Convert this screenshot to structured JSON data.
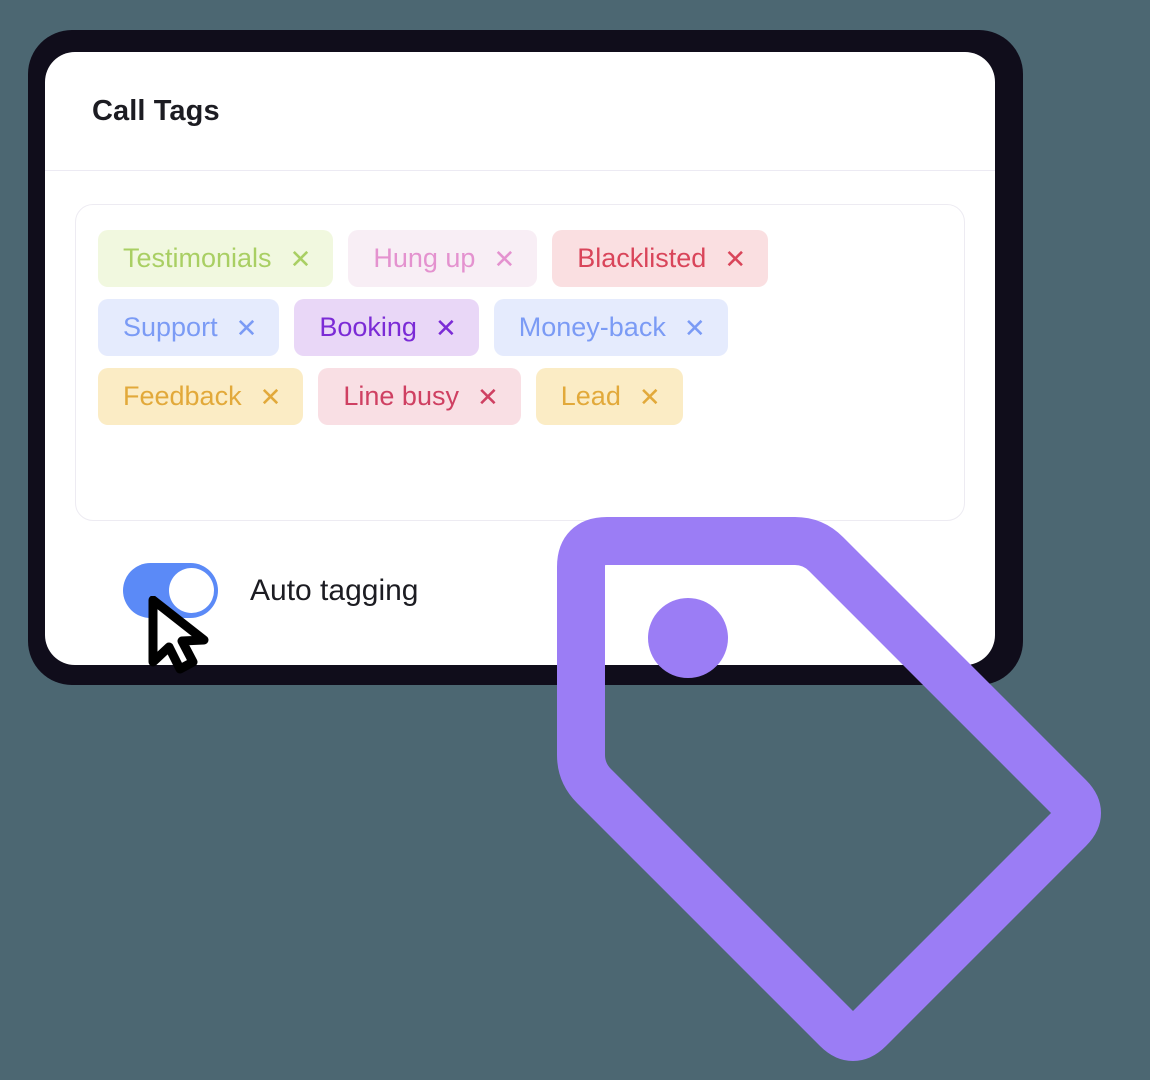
{
  "background": {
    "color": "#4c6772"
  },
  "card": {
    "title": "Call Tags",
    "background": "#ffffff",
    "shadow_color": "#100d1b"
  },
  "tags_panel": {
    "rows": [
      [
        {
          "label": "Testimonials",
          "remove_icon": "✕",
          "bg": "#f1f8df",
          "fg": "#a9cf63"
        },
        {
          "label": "Hung up",
          "remove_icon": "✕",
          "bg": "#f8eef5",
          "fg": "#e492cf"
        },
        {
          "label": "Blacklisted",
          "remove_icon": "✕",
          "bg": "#fadfe1",
          "fg": "#d9455a"
        }
      ],
      [
        {
          "label": "Support",
          "remove_icon": "✕",
          "bg": "#e5ebfd",
          "fg": "#7b9bf5"
        },
        {
          "label": "Booking",
          "remove_icon": "✕",
          "bg": "#e9d7f7",
          "fg": "#7b2bd6"
        },
        {
          "label": "Money-back",
          "remove_icon": "✕",
          "bg": "#e5ebfd",
          "fg": "#7b9bf5"
        }
      ],
      [
        {
          "label": "Feedback",
          "remove_icon": "✕",
          "bg": "#fbecc5",
          "fg": "#e2a93a"
        },
        {
          "label": "Line busy",
          "remove_icon": "✕",
          "bg": "#f9dfe4",
          "fg": "#cf4062"
        },
        {
          "label": "Lead",
          "remove_icon": "✕",
          "bg": "#fbecc5",
          "fg": "#e2a93a"
        }
      ]
    ]
  },
  "auto_tagging": {
    "label": "Auto tagging",
    "state": "on",
    "track_color": "#5b8af7",
    "knob_color": "#ffffff"
  },
  "cursor": {
    "icon": "mouse-pointer-arrow",
    "fill": "#ffffff",
    "stroke": "#000000"
  },
  "illustration": {
    "icon": "tag-icon",
    "color": "#9b7df5"
  }
}
